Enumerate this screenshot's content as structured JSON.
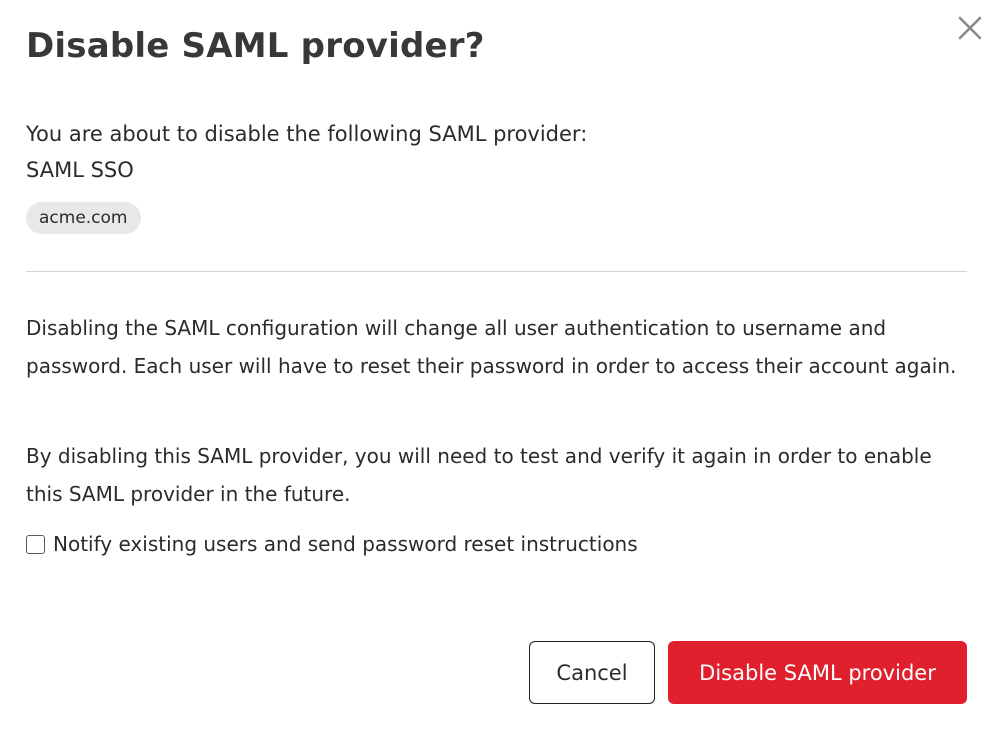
{
  "dialog": {
    "title": "Disable SAML provider?",
    "intro": "You are about to disable the following SAML provider:",
    "provider_name": "SAML SSO",
    "domain": "acme.com",
    "paragraph_1": "Disabling the SAML configuration will change all user authentication to username and password. Each user will have to reset their password in order to access their account again.",
    "paragraph_2": "By disabling this SAML provider, you will need to test and verify it again in order to enable this SAML provider in the future.",
    "notify_checkbox": {
      "label": "Notify existing users and send password reset instructions",
      "checked": false
    },
    "buttons": {
      "cancel_label": "Cancel",
      "confirm_label": "Disable SAML provider"
    },
    "icons": {
      "close": "close-icon"
    },
    "colors": {
      "danger": "#e0202c",
      "chip_background": "#e8e8e8",
      "divider": "#d4d4d4",
      "close_icon": "#8a8a8a"
    }
  }
}
